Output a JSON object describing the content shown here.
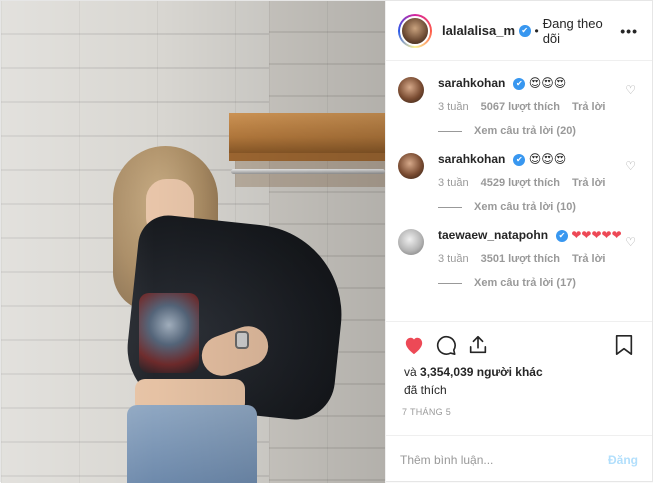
{
  "header": {
    "username": "lalalalisa_m",
    "verified": "✔",
    "separator": "•",
    "follow_status": "Đang theo dõi",
    "more": "•••"
  },
  "comments": [
    {
      "username": "sarahkohan",
      "verified": "✔",
      "text": "😍😍😍",
      "time": "3 tuần",
      "likes": "5067 lượt thích",
      "reply": "Trả lời",
      "view_replies": "Xem câu trả lời (20)"
    },
    {
      "username": "sarahkohan",
      "verified": "✔",
      "text": "😍😍😍",
      "time": "3 tuần",
      "likes": "4529 lượt thích",
      "reply": "Trả lời",
      "view_replies": "Xem câu trả lời (10)"
    },
    {
      "username": "taewaew_natapohn",
      "verified": "✔",
      "text": "❤❤❤❤❤",
      "time": "3 tuần",
      "likes": "3501 lượt thích",
      "reply": "Trả lời",
      "view_replies": "Xem câu trả lời (17)"
    }
  ],
  "likes": {
    "prefix": "và",
    "count": "3,354,039 người khác",
    "suffix": "đã thích"
  },
  "date": "7 THÁNG 5",
  "add_comment": {
    "placeholder": "Thêm bình luận...",
    "post_label": "Đăng"
  },
  "colors": {
    "like_red": "#ed4956",
    "verified_blue": "#3897f0",
    "post_disabled": "#b2dffc"
  }
}
